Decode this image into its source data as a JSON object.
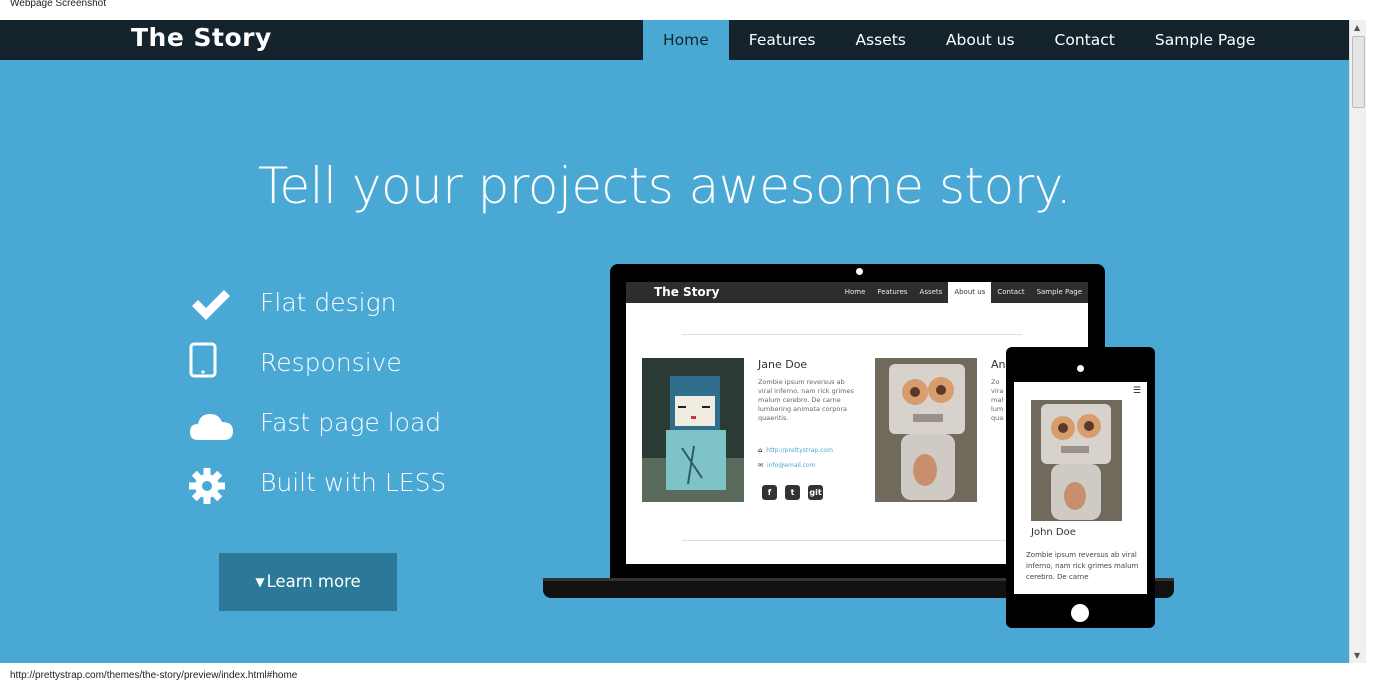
{
  "window": {
    "title": "Webpage Screenshot"
  },
  "navbar": {
    "brand": "The Story",
    "items": [
      {
        "label": "Home",
        "active": true
      },
      {
        "label": "Features",
        "active": false
      },
      {
        "label": "Assets",
        "active": false
      },
      {
        "label": "About us",
        "active": false
      },
      {
        "label": "Contact",
        "active": false
      },
      {
        "label": "Sample Page",
        "active": false
      }
    ]
  },
  "hero": {
    "headline": "Tell your projects awesome story.",
    "features": [
      {
        "icon": "check-icon",
        "label": "Flat design"
      },
      {
        "icon": "tablet-icon",
        "label": "Responsive"
      },
      {
        "icon": "cloud-icon",
        "label": "Fast page load"
      },
      {
        "icon": "gear-icon",
        "label": "Built with LESS"
      }
    ],
    "cta": "Learn more"
  },
  "laptop_preview": {
    "brand": "The Story",
    "nav": [
      "Home",
      "Features",
      "Assets",
      "About us",
      "Contact",
      "Sample Page"
    ],
    "active_nav": "About us",
    "profile": {
      "name": "Jane Doe",
      "bio": "Zombie ipsum reversus ab viral inferno, nam rick grimes malum cerebro. De carne lumbering animata corpora quaeritis.",
      "website": "http://prettystrap.com",
      "email": "info@email.com",
      "social": [
        "f",
        "t",
        "git"
      ]
    },
    "second_name": "An",
    "second_bio": "Zo vira mal lum qua"
  },
  "phone_preview": {
    "name": "John Doe",
    "bio": "Zombie ipsum reversus ab viral inferno, nam rick grimes malum cerebro. De carne"
  },
  "status_bar": {
    "url": "http://prettystrap.com/themes/the-story/preview/index.html#home"
  },
  "colors": {
    "hero_bg": "#4aa8d4",
    "navbar_bg": "#15232d",
    "button_bg": "#2b7899"
  }
}
